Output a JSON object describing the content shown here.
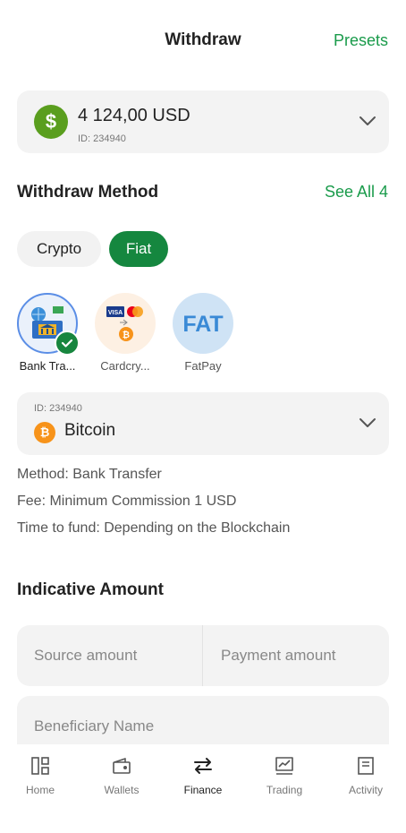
{
  "header": {
    "title": "Withdraw",
    "presets_label": "Presets"
  },
  "account": {
    "currency_symbol": "$",
    "amount": "4 124,00 USD",
    "id_label": "ID: 234940"
  },
  "withdraw_method": {
    "title": "Withdraw Method",
    "see_all": "See All 4",
    "tabs": [
      {
        "label": "Crypto",
        "active": false
      },
      {
        "label": "Fiat",
        "active": true
      }
    ],
    "methods": [
      {
        "label": "Bank Tra...",
        "selected": true,
        "icon": "bank-icon"
      },
      {
        "label": "Cardcry...",
        "selected": false,
        "icon": "card-crypto-icon"
      },
      {
        "label": "FatPay",
        "selected": false,
        "icon": "fatpay-logo",
        "logo_text": "FAT"
      }
    ]
  },
  "crypto": {
    "id_label": "ID: 234940",
    "symbol": "₿",
    "name": "Bitcoin"
  },
  "info": {
    "method": "Method: Bank Transfer",
    "fee": "Fee: Minimum Commission 1 USD",
    "time": "Time to fund: Depending on the Blockchain"
  },
  "indicative": {
    "title": "Indicative Amount",
    "source_placeholder": "Source amount",
    "payment_placeholder": "Payment amount",
    "beneficiary_placeholder": "Beneficiary Name"
  },
  "tabbar": [
    {
      "label": "Home",
      "icon": "home-icon",
      "active": false
    },
    {
      "label": "Wallets",
      "icon": "wallet-icon",
      "active": false
    },
    {
      "label": "Finance",
      "icon": "transfer-arrows-icon",
      "active": true
    },
    {
      "label": "Trading",
      "icon": "chart-icon",
      "active": false
    },
    {
      "label": "Activity",
      "icon": "document-icon",
      "active": false
    }
  ],
  "colors": {
    "accent": "#1a9b4b",
    "accent_dark": "#15873f",
    "card_bg": "#f3f3f3",
    "bitcoin": "#f7931a"
  }
}
